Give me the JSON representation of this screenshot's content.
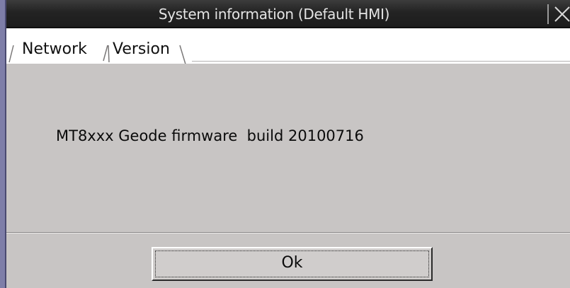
{
  "window": {
    "title": "System information (Default HMI)",
    "close_icon": "close-icon"
  },
  "tabs": [
    {
      "label": "Network",
      "selected": false
    },
    {
      "label": "Version",
      "selected": true
    }
  ],
  "version_panel": {
    "firmware_text": "MT8xxx Geode firmware  build 20100716"
  },
  "footer": {
    "ok_label": "Ok"
  },
  "colors": {
    "titlebar": "#232323",
    "title_text": "#e4e4e4",
    "panel_background": "#c8c5c4",
    "window_frame": "#7e7ea8"
  }
}
